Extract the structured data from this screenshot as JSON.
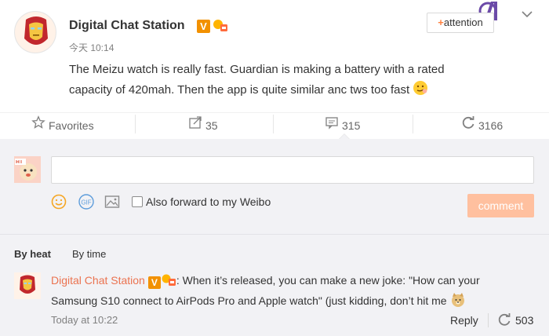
{
  "post": {
    "author": "Digital Chat Station",
    "verified_badge": "V",
    "time": "今天 10:14",
    "content": "The Meizu watch is really fast. Guardian is making a battery with a rated capacity of 420mah. Then the app is quite similar anc tws too fast",
    "attention_plus": "+",
    "attention_label": "attention"
  },
  "actions": {
    "favorites_label": "Favorites",
    "share_count": "35",
    "comment_count": "315",
    "repost_count": "3166"
  },
  "composer": {
    "input_value": "",
    "gif_label": "GIF",
    "forward_label": "Also forward to my Weibo",
    "comment_button": "comment"
  },
  "sort": {
    "by_heat": "By heat",
    "by_time": "By time"
  },
  "reply": {
    "author": "Digital Chat Station",
    "verified_badge": "V",
    "text": ": When it’s released, you can make a new joke: \"How can your Samsung S10 connect to AirPods Pro and Apple watch\" (just kidding, don’t hit me",
    "time": "Today at 10:22",
    "reply_label": "Reply",
    "repost_count": "503"
  },
  "colors": {
    "accent_orange": "#eb7350",
    "comment_button_bg": "#ffc09f",
    "badge_orange": "#f29100",
    "panel_bg": "#f2f2f5"
  }
}
